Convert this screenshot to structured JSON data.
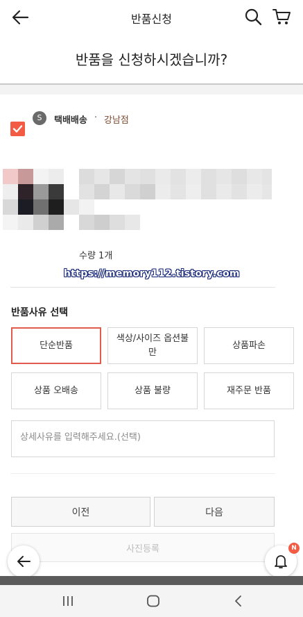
{
  "header": {
    "title": "반품신청",
    "back_icon": "arrow-left-icon",
    "search_icon": "search-icon",
    "cart_icon": "cart-icon"
  },
  "question": "반품을 신청하시겠습니까?",
  "shipping": {
    "icon_letter": "S",
    "type": "택배배송",
    "separator": "·",
    "store": "강남점",
    "checked": true
  },
  "product": {
    "quantity": "수량 1개"
  },
  "watermark": "https://memory112.tistory.com",
  "reasons": {
    "title": "반품사유 선택",
    "options": [
      {
        "label": "단순반품",
        "selected": true
      },
      {
        "label": "색상/사이즈 옵션불만",
        "selected": false
      },
      {
        "label": "상품파손",
        "selected": false
      },
      {
        "label": "상품 오배송",
        "selected": false
      },
      {
        "label": "상품 불량",
        "selected": false
      },
      {
        "label": "재주문 반품",
        "selected": false
      }
    ],
    "detail_placeholder": "상세사유를 입력해주세요.(선택)"
  },
  "actions": {
    "prev": "이전",
    "next": "다음",
    "photo": "사진등록"
  },
  "floating": {
    "badge": "N"
  },
  "colors": {
    "accent": "#f25c45",
    "selected_border": "#e35a4a",
    "store_text": "#7b4a2e",
    "watermark_outline": "#1a2a7a"
  }
}
